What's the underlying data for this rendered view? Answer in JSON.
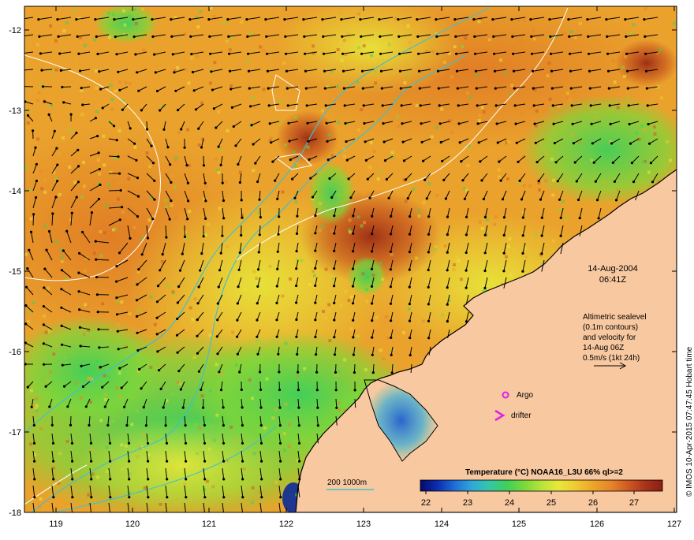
{
  "map": {
    "x_ticks": [
      "119",
      "120",
      "121",
      "122",
      "123",
      "124",
      "125",
      "126",
      "127"
    ],
    "y_ticks": [
      "-12",
      "-13",
      "-14",
      "-15",
      "-16",
      "-17",
      "-18"
    ],
    "date": "14-Aug-2004",
    "time": "06:41Z",
    "annotation": [
      "Altimetric sealevel",
      "(0.1m contours)",
      "and velocity for",
      "14-Aug 06Z",
      "0.5m/s (1kt 24h)"
    ],
    "argo_label": "Argo",
    "drifter_label": "drifter",
    "depth_label": "200  1000m",
    "credit": "© IMOS 10-Apr-2015 07:47:45 Hobart time"
  },
  "colorbar": {
    "title": "Temperature (°C) NOAA16_L3U 66% ql>=2",
    "ticks": [
      "22",
      "23",
      "24",
      "25",
      "26",
      "27"
    ],
    "colors": [
      "#08086b",
      "#0a2fb0",
      "#1f6fd8",
      "#2fa9d8",
      "#35c7a8",
      "#3fcf5a",
      "#7bd83a",
      "#b9e33a",
      "#e8e83a",
      "#f0c832",
      "#eca52a",
      "#e6852a",
      "#cf5a22",
      "#a8331a",
      "#8a1f12"
    ]
  },
  "colors": {
    "land": "#f8c8a0",
    "coast": "#000000",
    "isobath": "#40c0d0",
    "contour": "#ffffff",
    "argo": "#e020e0",
    "drifter": "#e020e0"
  }
}
